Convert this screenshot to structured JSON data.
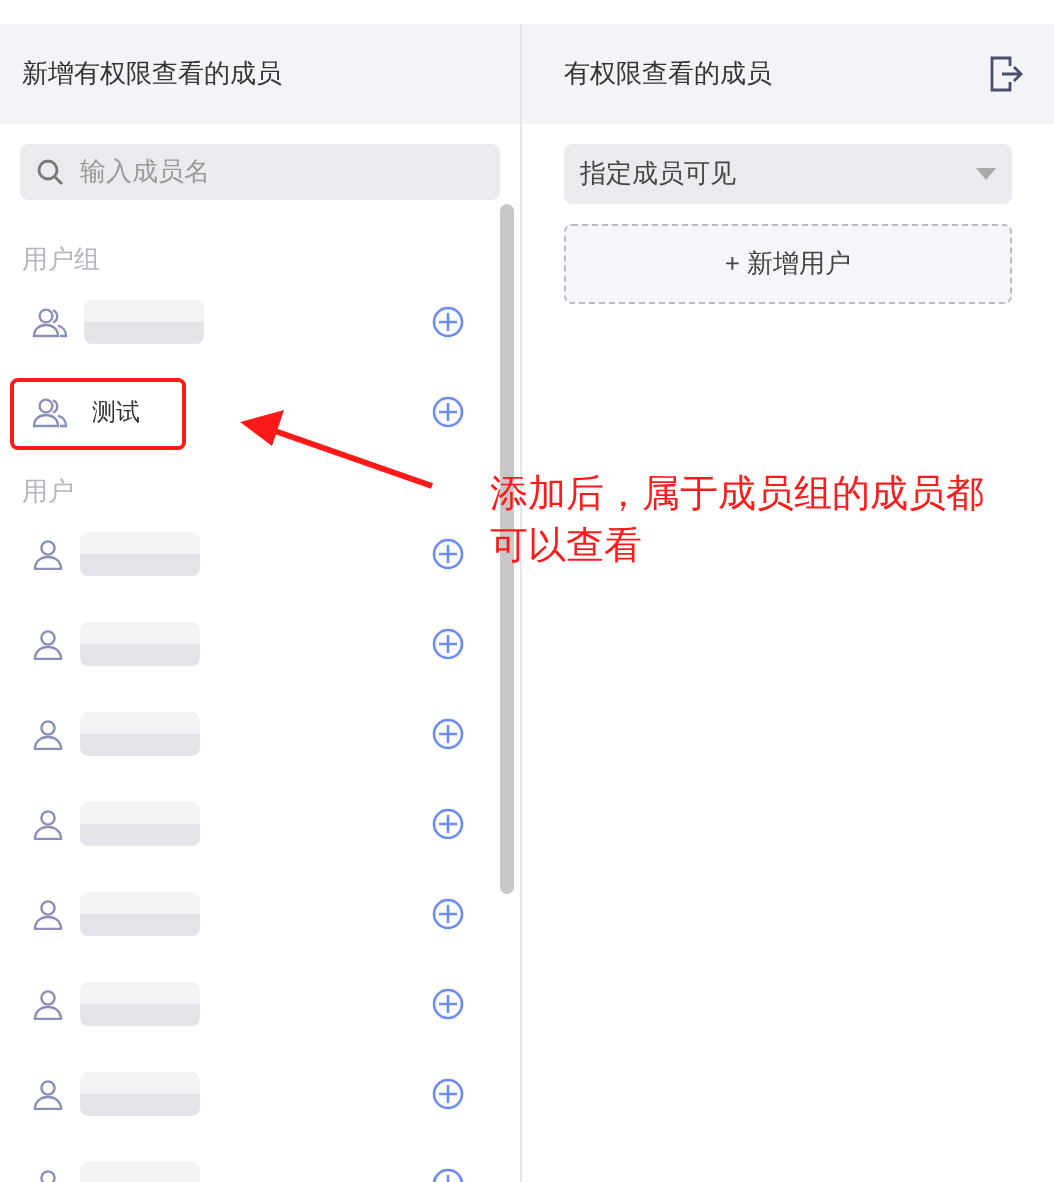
{
  "left_panel": {
    "title": "新增有权限查看的成员",
    "search": {
      "placeholder": "输入成员名"
    },
    "sections": [
      {
        "label": "用户组",
        "items": [
          {
            "kind": "group"
          },
          {
            "kind": "group",
            "name": "测试"
          }
        ]
      },
      {
        "label": "用户",
        "items": [
          {
            "kind": "user"
          },
          {
            "kind": "user"
          },
          {
            "kind": "user"
          },
          {
            "kind": "user"
          },
          {
            "kind": "user"
          },
          {
            "kind": "user"
          },
          {
            "kind": "user"
          },
          {
            "kind": "user"
          }
        ]
      }
    ]
  },
  "right_panel": {
    "title": "有权限查看的成员",
    "visibility_select": {
      "value": "指定成员可见"
    },
    "add_button": "+ 新增用户"
  },
  "annotation": {
    "text": "添加后，属于成员组的成员都可以查看"
  }
}
